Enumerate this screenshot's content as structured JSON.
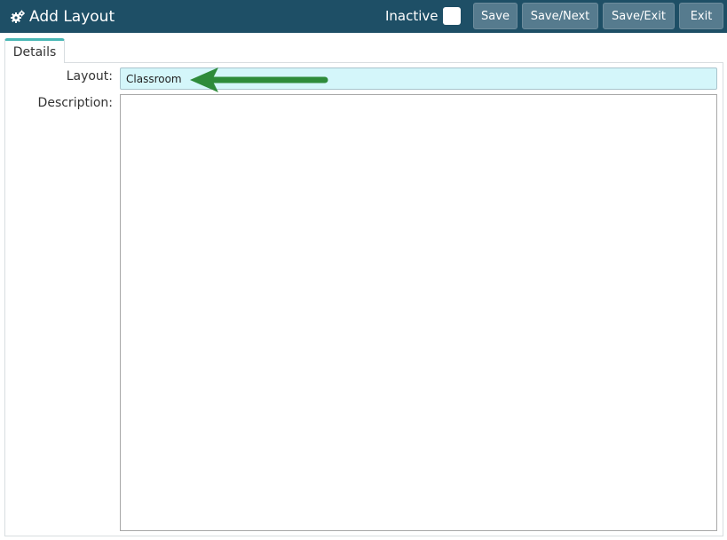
{
  "header": {
    "title": "Add Layout",
    "title_icon": "gear-icon",
    "inactive_label": "Inactive",
    "inactive_checked": false,
    "buttons": {
      "save": "Save",
      "save_next": "Save/Next",
      "save_exit": "Save/Exit",
      "exit": "Exit"
    }
  },
  "tabs": [
    {
      "label": "Details",
      "active": true
    }
  ],
  "form": {
    "layout_label": "Layout:",
    "layout_value": "Classroom",
    "description_label": "Description:",
    "description_value": ""
  },
  "annotation": {
    "icon": "arrow-left-icon",
    "color": "#2e8b3a"
  },
  "colors": {
    "header_bg": "#1e4f66",
    "button_bg": "#567b8e",
    "tab_accent": "#49b7b5",
    "input_highlight": "#d4f6fa"
  }
}
